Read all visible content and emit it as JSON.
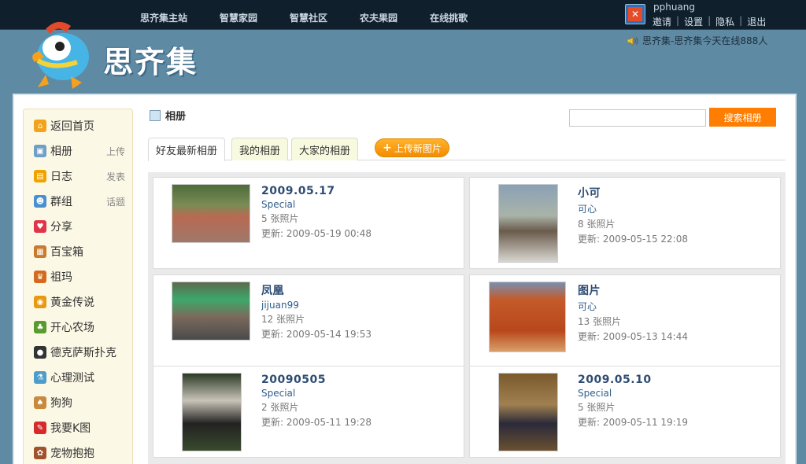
{
  "topnav": [
    "思齐集主站",
    "智慧家园",
    "智慧社区",
    "农夫果园",
    "在线挑歌"
  ],
  "user": {
    "name": "pphuang",
    "links": [
      "邀请",
      "设置",
      "隐私",
      "退出"
    ]
  },
  "header": {
    "logo": "思齐集",
    "online_text": "思齐集-思齐集今天在线888人"
  },
  "sidebar": {
    "items": [
      {
        "label": "返回首页",
        "sub": "",
        "icon": "home-icon",
        "color": "#f3a31b"
      },
      {
        "label": "相册",
        "sub": "上传",
        "icon": "album-icon",
        "color": "#6f9fc7"
      },
      {
        "label": "日志",
        "sub": "发表",
        "icon": "blog-icon",
        "color": "#f0a300"
      },
      {
        "label": "群组",
        "sub": "话题",
        "icon": "group-icon",
        "color": "#4a8fd0"
      },
      {
        "label": "分享",
        "sub": "",
        "icon": "share-icon",
        "color": "#e0344a"
      },
      {
        "label": "百宝箱",
        "sub": "",
        "icon": "treasure-icon",
        "color": "#c97a2d"
      },
      {
        "label": "祖玛",
        "sub": "",
        "icon": "zuma-icon",
        "color": "#d36a1e"
      },
      {
        "label": "黄金传说",
        "sub": "",
        "icon": "gold-icon",
        "color": "#e69a14"
      },
      {
        "label": "开心农场",
        "sub": "",
        "icon": "farm-icon",
        "color": "#5a9b2d"
      },
      {
        "label": "德克萨斯扑克",
        "sub": "",
        "icon": "poker-icon",
        "color": "#333333"
      },
      {
        "label": "心理测试",
        "sub": "",
        "icon": "test-icon",
        "color": "#4d9cc9"
      },
      {
        "label": "狗狗",
        "sub": "",
        "icon": "dog-icon",
        "color": "#c98a3e"
      },
      {
        "label": "我要K图",
        "sub": "",
        "icon": "kpic-icon",
        "color": "#d72b2b"
      },
      {
        "label": "宠物抱抱",
        "sub": "",
        "icon": "pet-icon",
        "color": "#a0522d"
      }
    ]
  },
  "content": {
    "title": "相册",
    "search_button": "搜索相册",
    "tabs": [
      "好友最新相册",
      "我的相册",
      "大家的相册"
    ],
    "upload_button": "上传新图片",
    "albums": [
      {
        "name": "2009.05.17",
        "owner": "Special",
        "count": "5 张照片",
        "updated": "更新: 2009-05-19 00:48"
      },
      {
        "name": "小可",
        "owner": "可心",
        "count": "8 张照片",
        "updated": "更新: 2009-05-15 22:08"
      },
      {
        "name": "凤凰",
        "owner": "jijuan99",
        "count": "12 张照片",
        "updated": "更新: 2009-05-14 19:53"
      },
      {
        "name": "图片",
        "owner": "可心",
        "count": "13 张照片",
        "updated": "更新: 2009-05-13 14:44"
      },
      {
        "name": "20090505",
        "owner": "Special",
        "count": "2 张照片",
        "updated": "更新: 2009-05-11 19:28"
      },
      {
        "name": "2009.05.10",
        "owner": "Special",
        "count": "5 张照片",
        "updated": "更新: 2009-05-11 19:19"
      }
    ]
  }
}
